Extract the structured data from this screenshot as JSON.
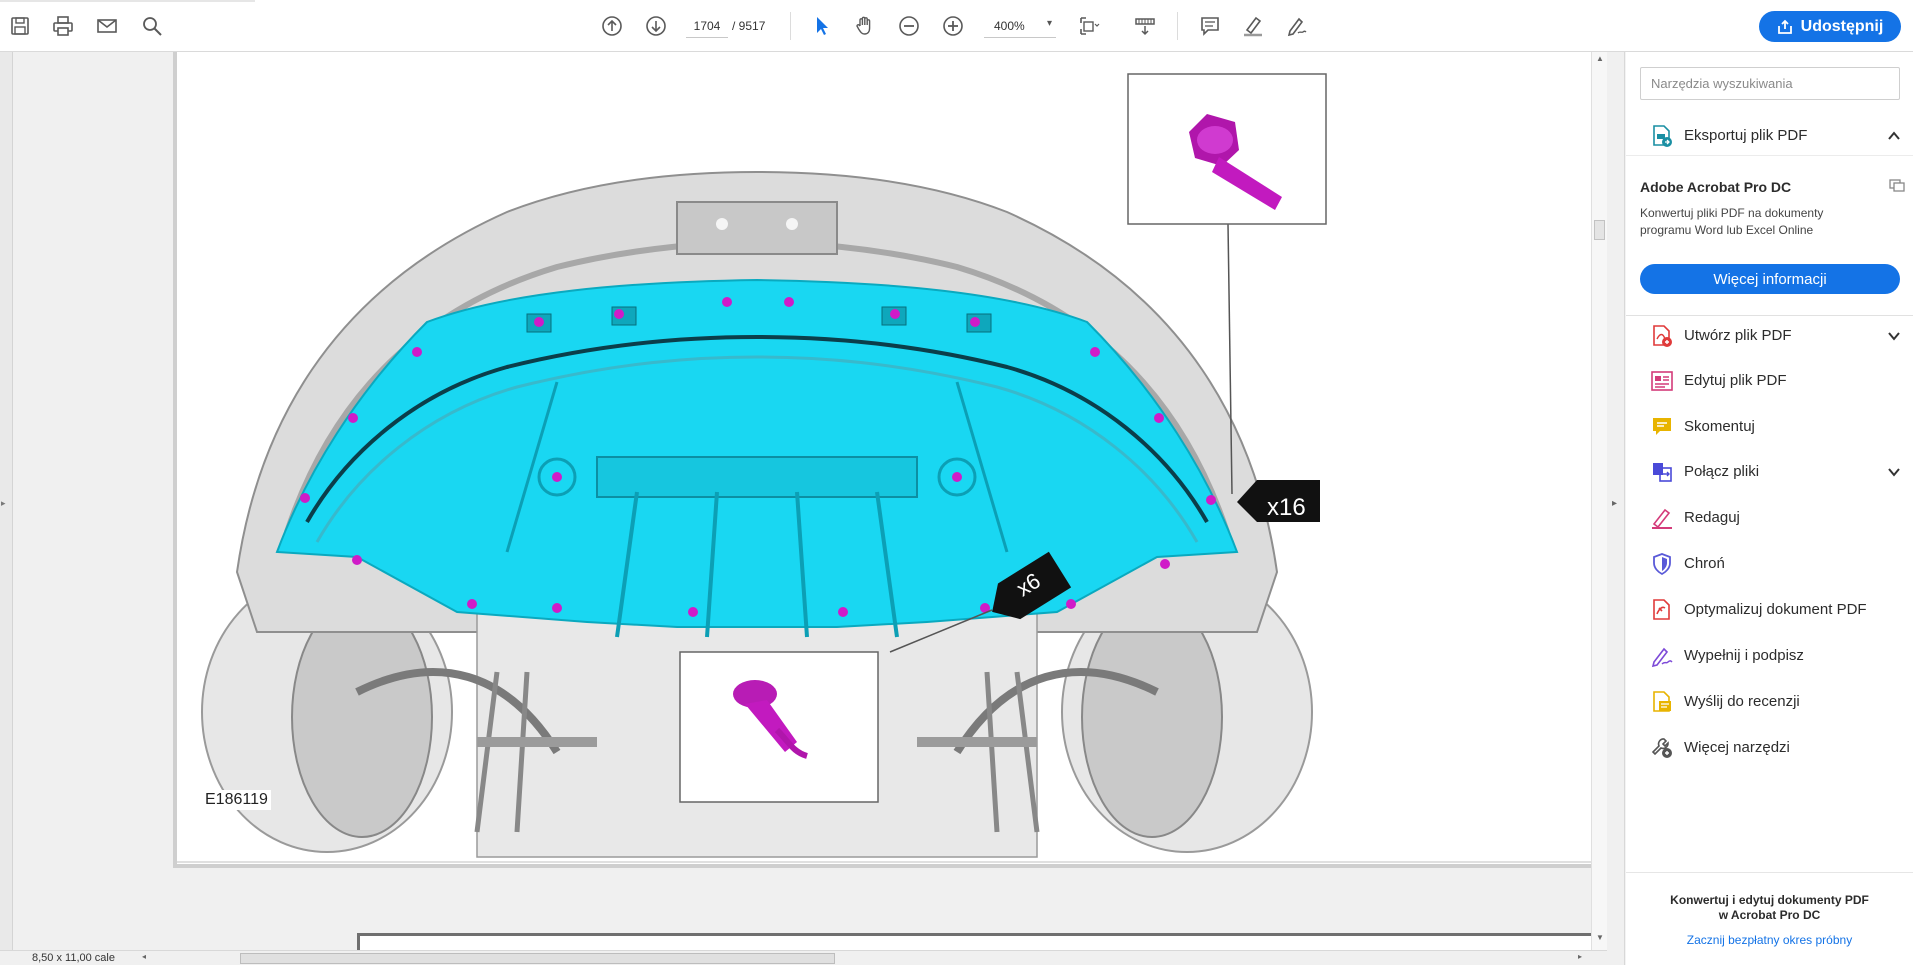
{
  "toolbar": {
    "icons": [
      "save-icon",
      "print-icon",
      "email-icon",
      "search-icon",
      "page-up-icon",
      "page-down-icon",
      "select-arrow-icon",
      "hand-icon",
      "zoom-out-icon",
      "zoom-in-icon",
      "fit-page-icon",
      "scroll-mode-icon",
      "comment-icon",
      "highlight-icon",
      "sign-icon"
    ],
    "page_current": "1704",
    "page_total": "/ 9517",
    "zoom": "400%",
    "share_label": "Udostępnij"
  },
  "document": {
    "image_code": "E186119",
    "callout_right": "x16",
    "callout_bottom": "x6",
    "colors": {
      "panel": "#19d7f2",
      "fastener": "#d01bc8",
      "car_body": "#dcdcdc"
    }
  },
  "statusbar": {
    "page_size": "8,50 x 11,00 cale"
  },
  "panel": {
    "search_placeholder": "Narzędzia wyszukiwania",
    "export_label": "Eksportuj plik PDF",
    "promo_title": "Adobe Acrobat Pro DC",
    "promo_desc": "Konwertuj pliki PDF na dokumenty programu Word lub Excel Online",
    "promo_button": "Więcej informacji",
    "tools": [
      {
        "label": "Utwórz plik PDF",
        "icon": "create-pdf-icon",
        "color": "#e03a3a"
      },
      {
        "label": "Edytuj plik PDF",
        "icon": "edit-pdf-icon",
        "color": "#d43b7a"
      },
      {
        "label": "Skomentuj",
        "icon": "comment-icon",
        "color": "#e8b400"
      },
      {
        "label": "Połącz pliki",
        "icon": "combine-files-icon",
        "color": "#4a4ad8"
      },
      {
        "label": "Redaguj",
        "icon": "redact-icon",
        "color": "#d43b7a"
      },
      {
        "label": "Chroń",
        "icon": "protect-icon",
        "color": "#5a5ad8"
      },
      {
        "label": "Optymalizuj dokument PDF",
        "icon": "optimize-pdf-icon",
        "color": "#e03a3a"
      },
      {
        "label": "Wypełnij i podpisz",
        "icon": "fill-sign-icon",
        "color": "#7d4ad8"
      },
      {
        "label": "Wyślij do recenzji",
        "icon": "send-review-icon",
        "color": "#e8b400"
      },
      {
        "label": "Więcej narzędzi",
        "icon": "more-tools-icon",
        "color": "#555555"
      }
    ],
    "bottom_title_1": "Konwertuj i edytuj dokumenty PDF",
    "bottom_title_2": "w Acrobat Pro DC",
    "bottom_link": "Zacznij bezpłatny okres próbny"
  }
}
